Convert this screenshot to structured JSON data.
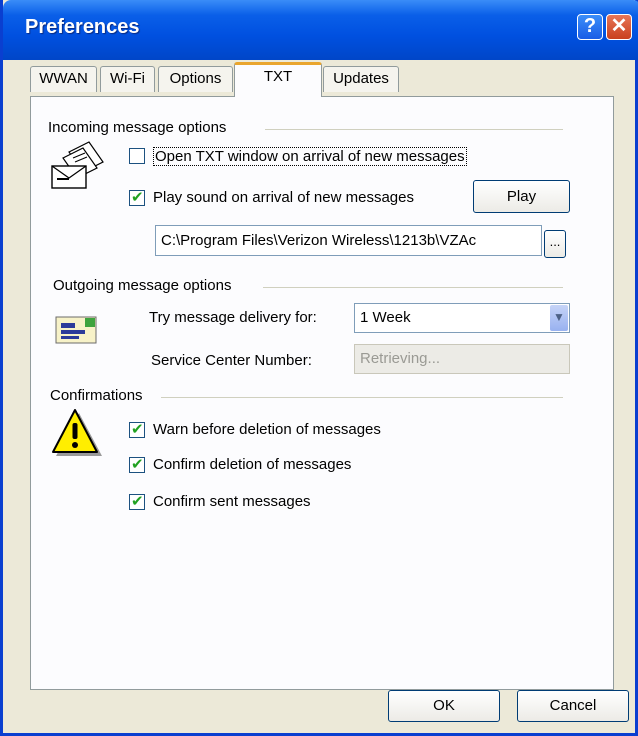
{
  "window": {
    "title": "Preferences"
  },
  "titlebar": {
    "help_glyph": "?",
    "close_glyph": "✕"
  },
  "tabs": [
    {
      "label": "WWAN"
    },
    {
      "label": "Wi-Fi"
    },
    {
      "label": "Options"
    },
    {
      "label": "TXT",
      "active": true
    },
    {
      "label": "Updates"
    }
  ],
  "incoming": {
    "title": "Incoming message options",
    "open_window": {
      "label": "Open TXT window on arrival of new messages",
      "checked": false
    },
    "play_sound": {
      "label": "Play sound on arrival of new messages",
      "checked": true
    },
    "play_button": "Play",
    "sound_path": "C:\\Program Files\\Verizon Wireless\\1213b\\VZAc",
    "browse_button": "..."
  },
  "outgoing": {
    "title": "Outgoing message options",
    "delivery_label": "Try message delivery for:",
    "delivery_value": "1 Week",
    "service_center_label": "Service Center Number:",
    "service_center_value": "Retrieving..."
  },
  "confirmations": {
    "title": "Confirmations",
    "warn_delete": {
      "label": "Warn before deletion of messages",
      "checked": true
    },
    "confirm_delete": {
      "label": "Confirm deletion of messages",
      "checked": true
    },
    "confirm_sent": {
      "label": "Confirm sent messages",
      "checked": true
    }
  },
  "footer": {
    "ok": "OK",
    "cancel": "Cancel"
  },
  "colors": {
    "title_bar": "#0050e0",
    "active_tab_accent": "#e9a52e",
    "check": "#21a121"
  },
  "icons": [
    "mail-stack-icon",
    "outbox-icon",
    "warning-icon",
    "help-icon",
    "close-icon",
    "chevron-down-icon"
  ]
}
